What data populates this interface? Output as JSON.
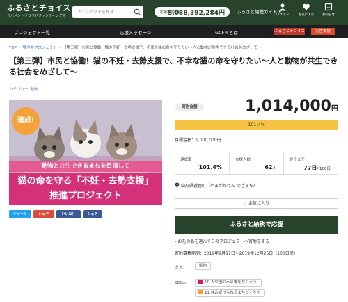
{
  "header": {
    "logo_main": "ふるさとチョイス",
    "logo_sub": "ガバメントクラウドファンディング®",
    "search_placeholder": "プロジェクトを探す",
    "donors_label": "応援寄附総額",
    "donors_value": "5,038,392,284円",
    "guide": "ふるさと納税ガイド ▾",
    "icons": [
      {
        "name": "login",
        "label": "ログイン"
      },
      {
        "name": "favorites",
        "label": "お気に入り"
      },
      {
        "name": "history",
        "label": "お知らせ"
      }
    ]
  },
  "nav": {
    "items": [
      "プロジェクト一覧",
      "応援メッセージ",
      "GCF®とは"
    ],
    "btn_furusato": "ふるさとチョイス",
    "btn_disaster": "災害支援"
  },
  "breadcrumb": [
    "TOP",
    "受付中プロジェクト",
    "【第三弾】市民と協働！猫の不妊・去勢支援で、不幸な猫の命を守りたい〜人と動物が共生できる社会をめざして〜"
  ],
  "project": {
    "title": "【第三弾】市民と協働！猫の不妊・去勢支援で、不幸な猫の命を守りたい〜人と動物が共生できる社会をめざして〜",
    "category_label": "カテゴリー:",
    "category": "動物",
    "hero": {
      "badge": "達成!",
      "sub": "動物と共生できるまちを目指して",
      "main": "猫の命を守る「不妊・去勢支援」",
      "foot": "推進プロジェクト"
    },
    "share": [
      "ツイート",
      "シェア",
      "いいね！",
      "シェア"
    ]
  },
  "funding": {
    "amount_label": "寄附金額",
    "amount": "1,014,000",
    "amount_unit": "円",
    "progress_text": "101.4%",
    "progress_fraction": 1.0,
    "goal": "目標金額：1,000,000円",
    "stats": [
      {
        "label": "達成率",
        "value": "101.4%",
        "suffix": ""
      },
      {
        "label": "支援人数",
        "value": "62",
        "suffix": "人"
      },
      {
        "label": "終了まで",
        "value": "77日",
        "suffix": "/ 100日"
      }
    ],
    "location": "山形県遊佐町（やまがたけん ゆざまち）",
    "favorite": "♡ お気に入り",
    "cta": "ふるさと納税で応援",
    "info_link": "お礼の品を選んでこのプロジェクトへ寄附をする",
    "period": "寄附募集期間：2019年9月17日～2019年12月25日（100日間）",
    "tag_label": "タグ:",
    "tag": "動物",
    "sdgs_label": "SDGs:",
    "sdgs": [
      {
        "label": "10.人や国の不平等をなくそう",
        "color": "#dd1367"
      },
      {
        "label": "11.住み続けられるまちづくりを",
        "color": "#f99d26"
      }
    ]
  },
  "colors": {
    "header_bg": "#27432c",
    "nav_bg": "#1f1f1f",
    "progress": "#f5c244",
    "cta": "#27432c",
    "hero_pink": "#d4317a"
  }
}
